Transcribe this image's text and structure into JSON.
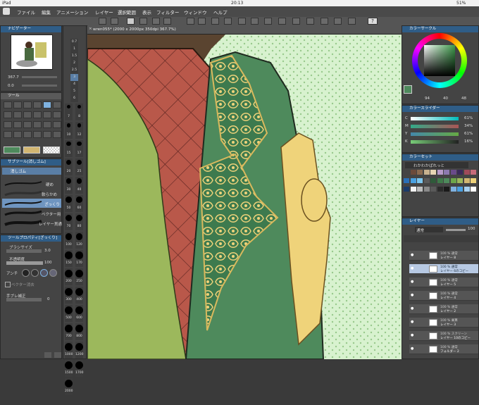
{
  "status": {
    "left": "iPad",
    "time": "20:13",
    "battery": "51%"
  },
  "menu": [
    "ファイル",
    "編集",
    "アニメーション",
    "レイヤー",
    "選択範囲",
    "表示",
    "フィルター",
    "ウィンドウ",
    "ヘルプ"
  ],
  "canvas": {
    "tab_title": "wren055* (2000 x 2000px 350dpi 367.7%)"
  },
  "navigator": {
    "title": "ナビゲーター",
    "zoom": "367.7",
    "angle": "0.0"
  },
  "tool": {
    "title": "ツール"
  },
  "subtool": {
    "title": "サブツール[消しゴム]",
    "group": "消しゴム",
    "items": [
      "硬め",
      "軟らかめ",
      "ざっくり",
      "ベクター用",
      "レイヤー貫通"
    ]
  },
  "tool_property": {
    "title": "ツールプロパティ[ざっくり]",
    "brush_size_label": "ブラシサイズ",
    "brush_size": "3.0",
    "opacity_label": "不透明度",
    "opacity": "100",
    "antialias_label": "アンチ",
    "vector_label": "ベクター消去",
    "stabilize_label": "手ブレ補正",
    "stabilize": "0"
  },
  "brush_sizes": [
    "0.7",
    "1",
    "1.5",
    "2",
    "2.5",
    "3",
    "4",
    "5",
    "6",
    "7",
    "8",
    "10",
    "12",
    "15",
    "17",
    "20",
    "25",
    "30",
    "40",
    "50",
    "60",
    "70",
    "80",
    "100",
    "120",
    "150",
    "170",
    "200",
    "250",
    "300",
    "400",
    "500",
    "600",
    "700",
    "800",
    "1000",
    "1200",
    "1500",
    "1700",
    "2000"
  ],
  "color_circle": {
    "title": "カラーサークル",
    "h": "94",
    "s": "40",
    "v": "48"
  },
  "color_slider": {
    "title": "カラースライダー",
    "rows": [
      [
        "C",
        "61%"
      ],
      [
        "M",
        "34%"
      ],
      [
        "Y",
        "61%"
      ],
      [
        "K",
        "16%"
      ]
    ]
  },
  "color_set": {
    "title": "カラーセット",
    "name": "わかわかぱれっと"
  },
  "layers": {
    "title": "レイヤー",
    "blend": "通常",
    "opacity": "100",
    "rows": [
      {
        "pct": "100 % 通常",
        "name": "レイヤー 8"
      },
      {
        "pct": "100 % 通常",
        "name": "レイヤー 6のコピー"
      },
      {
        "pct": "100 % 通常",
        "name": "レイヤー 5"
      },
      {
        "pct": "100 % 通常",
        "name": "レイヤー 4"
      },
      {
        "pct": "100 % 通常",
        "name": "レイヤー 2"
      },
      {
        "pct": "100 % 乗算",
        "name": "レイヤー 3"
      },
      {
        "pct": "100 % スクリーン",
        "name": "レイヤー 10のコピー"
      },
      {
        "pct": "100 % 通常",
        "name": "フォルダー 2"
      }
    ]
  },
  "colors": {
    "accent": "#2f5d87",
    "canvas_bg": "#d8f2cf",
    "cloak": "#4e8a5c",
    "gold": "#efd37a",
    "red": "#b9584a",
    "sleeve": "#9cb85c"
  }
}
